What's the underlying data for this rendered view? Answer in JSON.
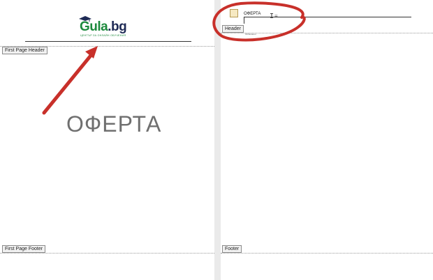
{
  "left_page": {
    "logo": {
      "word_main": "Gula",
      "word_ext": ".bg",
      "tagline": "ЦЕНТЪР ЗА ОНЛАЙН ОБУЧЕНИЯ"
    },
    "header_label": "First Page Header",
    "footer_label": "First Page Footer",
    "title": "ОФЕРТА"
  },
  "right_page": {
    "header_label": "Header",
    "footer_label": "Footer",
    "header_text": "ОФЕРТА",
    "header_subtext": "Obhanaeuu"
  },
  "colors": {
    "annotation": "#c8302a",
    "logo_green": "#1d8a3d",
    "logo_navy": "#1e2a55"
  }
}
